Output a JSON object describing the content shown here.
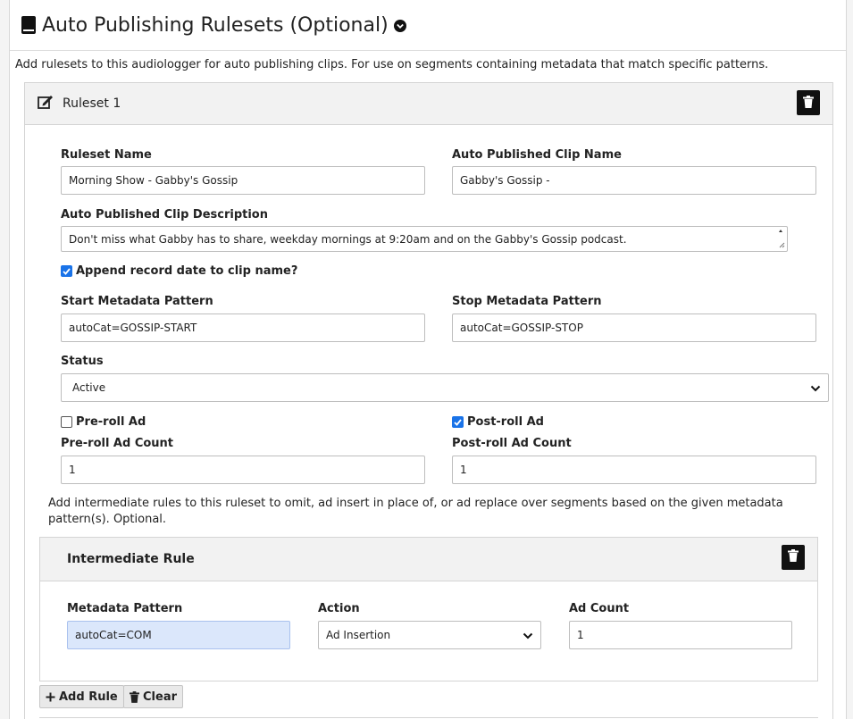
{
  "header": {
    "title": "Auto Publishing Rulesets (Optional)",
    "description": "Add rulesets to this audiologger for auto publishing clips. For use on segments containing metadata that match specific patterns."
  },
  "ruleset": {
    "title": "Ruleset 1",
    "name_label": "Ruleset Name",
    "name_value": "Morning Show - Gabby's Gossip",
    "clip_name_label": "Auto Published Clip Name",
    "clip_name_value": "Gabby's Gossip -",
    "clip_desc_label": "Auto Published Clip Description",
    "clip_desc_value": "Don't miss what Gabby has to share, weekday mornings at 9:20am and on the Gabby's Gossip podcast.",
    "append_date_label": "Append record date to clip name?",
    "append_date_checked": true,
    "start_pattern_label": "Start Metadata Pattern",
    "start_pattern_value": "autoCat=GOSSIP-START",
    "stop_pattern_label": "Stop Metadata Pattern",
    "stop_pattern_value": "autoCat=GOSSIP-STOP",
    "status_label": "Status",
    "status_value": "Active",
    "preroll_label": "Pre-roll Ad",
    "preroll_checked": false,
    "postroll_label": "Post-roll Ad",
    "postroll_checked": true,
    "preroll_count_label": "Pre-roll Ad Count",
    "preroll_count_value": "1",
    "postroll_count_label": "Post-roll Ad Count",
    "postroll_count_value": "1",
    "intermediate_info": "Add intermediate rules to this ruleset to omit, ad insert in place of, or ad replace over segments based on the given metadata pattern(s). Optional."
  },
  "intermediate_rule": {
    "title": "Intermediate Rule",
    "pattern_label": "Metadata Pattern",
    "pattern_value": "autoCat=COM",
    "action_label": "Action",
    "action_value": "Ad Insertion",
    "ad_count_label": "Ad Count",
    "ad_count_value": "1"
  },
  "buttons": {
    "add_rule": "Add Rule",
    "clear": "Clear"
  },
  "colors": {
    "checkbox_accent": "#1a73e8",
    "highlight_input": "#dbe7fb",
    "header_bg": "#f2f2f2"
  },
  "icons": [
    "book-icon",
    "chevron-circle-down-icon",
    "edit-icon",
    "trash-icon",
    "chevron-down-icon",
    "plus-icon",
    "resize-grip-icon",
    "check-icon"
  ]
}
